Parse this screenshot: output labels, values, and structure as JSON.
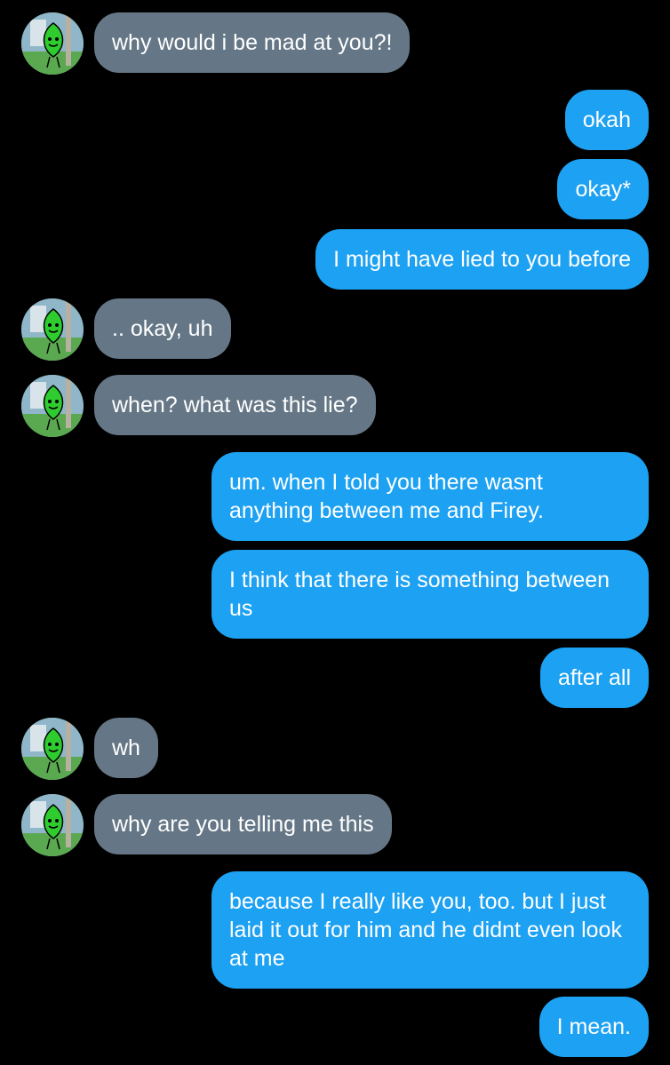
{
  "theme": {
    "background": "#000000",
    "incoming_bubble": "#657786",
    "outgoing_bubble": "#1da1f2",
    "text": "#ffffff"
  },
  "contact": {
    "avatar_icon": "leaf-character-avatar-icon"
  },
  "messages": [
    {
      "side": "incoming",
      "text": "why would i be mad at you?!"
    },
    {
      "side": "outgoing",
      "text": "okah"
    },
    {
      "side": "outgoing",
      "text": "okay*"
    },
    {
      "side": "outgoing",
      "text": "I might have lied to you before"
    },
    {
      "side": "incoming",
      "text": ".. okay, uh"
    },
    {
      "side": "incoming",
      "text": "when? what was this lie?"
    },
    {
      "side": "outgoing",
      "text": "um. when I told you there wasnt anything between me and Firey."
    },
    {
      "side": "outgoing",
      "text": "I think that there is something between us"
    },
    {
      "side": "outgoing",
      "text": "after all"
    },
    {
      "side": "incoming",
      "text": "wh"
    },
    {
      "side": "incoming",
      "text": "why are you telling me this"
    },
    {
      "side": "outgoing",
      "text": "because I really like you, too. but I just laid it out for him and he didnt even look at me"
    },
    {
      "side": "outgoing",
      "text": "I mean."
    }
  ]
}
